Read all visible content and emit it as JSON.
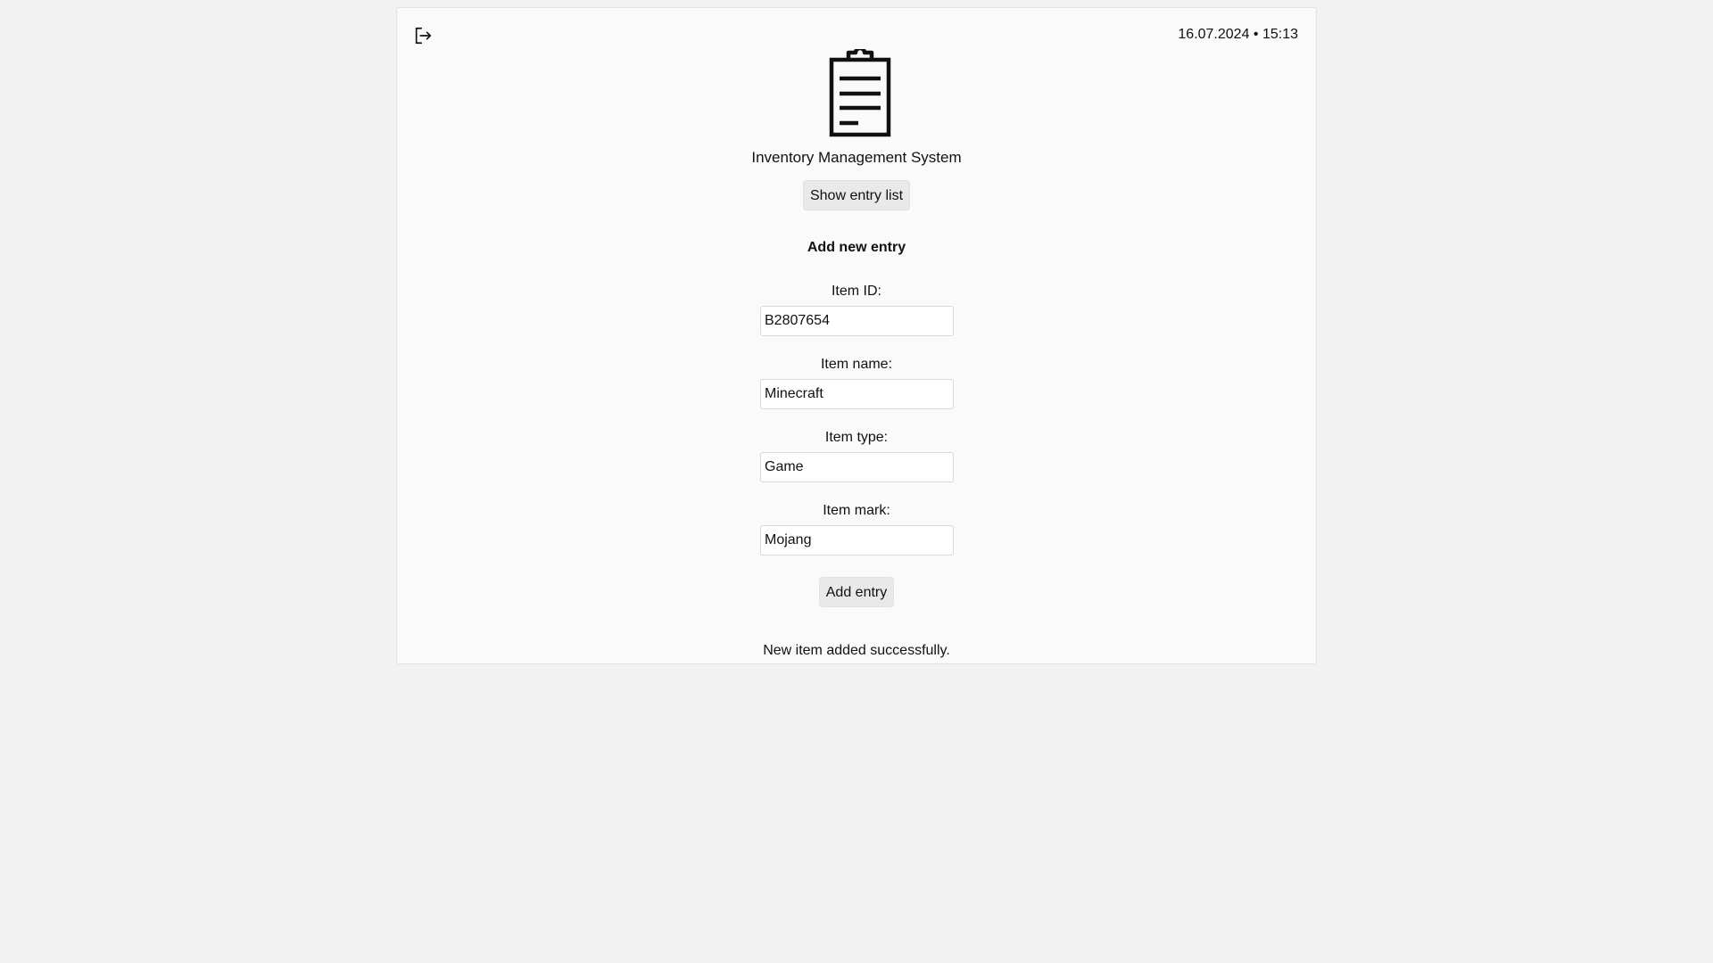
{
  "header": {
    "datetime": "16.07.2024 • 15:13",
    "app_title": "Inventory Management System",
    "show_list_label": "Show entry list"
  },
  "form": {
    "title": "Add new entry",
    "fields": [
      {
        "label": "Item ID:",
        "value": "B2807654"
      },
      {
        "label": "Item name:",
        "value": "Minecraft"
      },
      {
        "label": "Item type:",
        "value": "Game"
      },
      {
        "label": "Item mark:",
        "value": "Mojang"
      }
    ],
    "submit_label": "Add entry"
  },
  "status_message": "New item added successfully.",
  "icons": {
    "logout": "logout-icon",
    "logo": "clipboard-icon"
  },
  "colors": {
    "page_bg": "#f2f2f2",
    "card_bg": "#fafafa",
    "button_bg": "#e9e9e9"
  }
}
